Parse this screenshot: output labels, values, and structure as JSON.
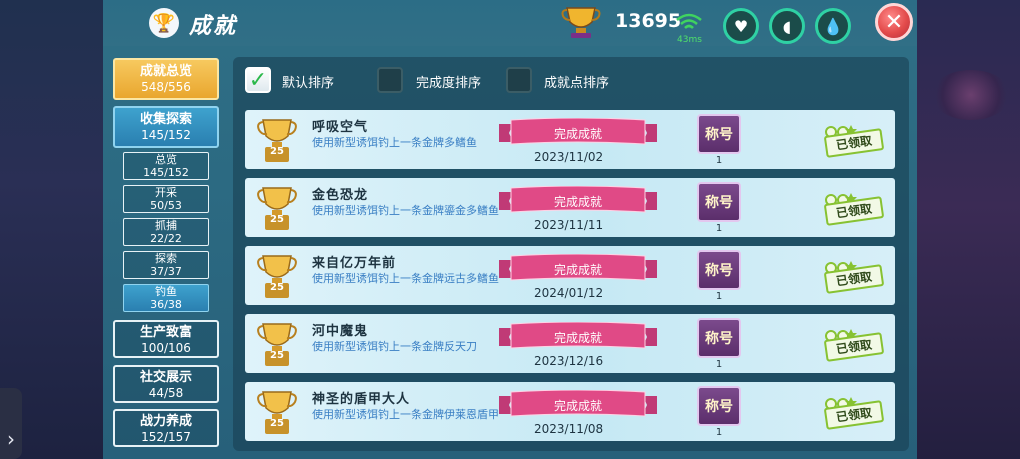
{
  "header": {
    "title": "成就",
    "points": "13695",
    "ping": "43ms",
    "close_label": "✕"
  },
  "sidebar": {
    "summary": {
      "label": "成就总览",
      "count": "548/556"
    },
    "explore": {
      "label": "收集探索",
      "count": "145/152"
    },
    "sub_items": [
      {
        "label": "总览",
        "count": "145/152"
      },
      {
        "label": "开采",
        "count": "50/53"
      },
      {
        "label": "抓捕",
        "count": "22/22"
      },
      {
        "label": "探索",
        "count": "37/37"
      },
      {
        "label": "钓鱼",
        "count": "36/38"
      }
    ],
    "categories": [
      {
        "label": "生产致富",
        "count": "100/106"
      },
      {
        "label": "社交展示",
        "count": "44/58"
      },
      {
        "label": "战力养成",
        "count": "152/157"
      }
    ]
  },
  "sort_options": [
    {
      "label": "默认排序",
      "checked": true
    },
    {
      "label": "完成度排序",
      "checked": false
    },
    {
      "label": "成就点排序",
      "checked": false
    }
  ],
  "achievements": [
    {
      "name": "呼吸空气",
      "desc": "使用新型诱饵钓上一条金牌多鳍鱼",
      "status": "完成成就",
      "date": "2023/11/02",
      "points": "25",
      "badge": "称号",
      "badge_count": "1",
      "claim": "已领取"
    },
    {
      "name": "金色恐龙",
      "desc": "使用新型诱饵钓上一条金牌鎏金多鳍鱼",
      "status": "完成成就",
      "date": "2023/11/11",
      "points": "25",
      "badge": "称号",
      "badge_count": "1",
      "claim": "已领取"
    },
    {
      "name": "来自亿万年前",
      "desc": "使用新型诱饵钓上一条金牌远古多鳍鱼",
      "status": "完成成就",
      "date": "2024/01/12",
      "points": "25",
      "badge": "称号",
      "badge_count": "1",
      "claim": "已领取"
    },
    {
      "name": "河中魔鬼",
      "desc": "使用新型诱饵钓上一条金牌反天刀",
      "status": "完成成就",
      "date": "2023/12/16",
      "points": "25",
      "badge": "称号",
      "badge_count": "1",
      "claim": "已领取"
    },
    {
      "name": "神圣的盾甲大人",
      "desc": "使用新型诱饵钓上一条金牌伊莱恩盾甲",
      "status": "完成成就",
      "date": "2023/11/08",
      "points": "25",
      "badge": "称号",
      "badge_count": "1",
      "claim": "已领取"
    }
  ],
  "colors": {
    "panel": "#2f6f86",
    "gold": "#e9a62e",
    "active_blue": "#2a7fb0",
    "ribbon": "#e04a86",
    "row_bg": "#dff3fa"
  }
}
